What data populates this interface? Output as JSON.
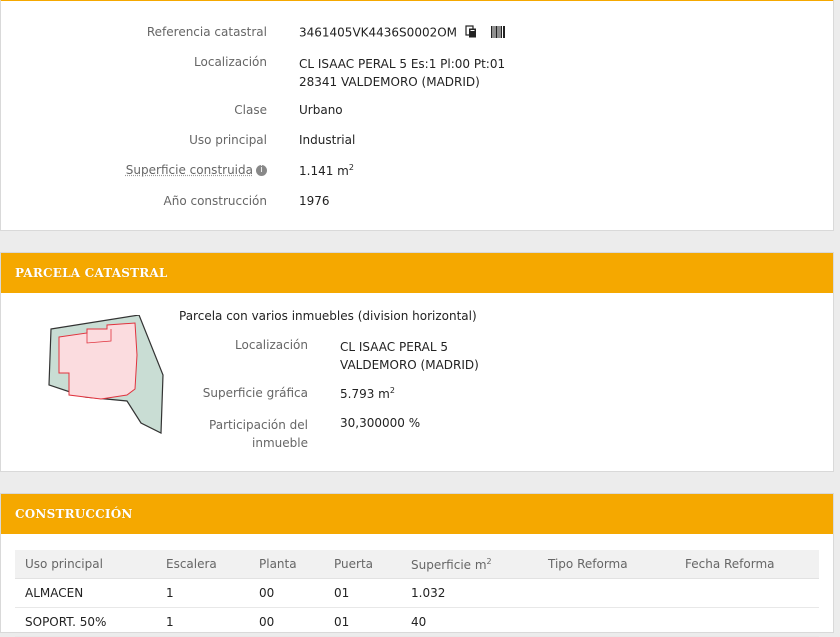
{
  "inmueble": {
    "ref_label": "Referencia catastral",
    "ref_value": "3461405VK4436S0002OM",
    "loc_label": "Localización",
    "loc_line1": "CL ISAAC PERAL 5 Es:1 Pl:00 Pt:01",
    "loc_line2": "28341 VALDEMORO (MADRID)",
    "clase_label": "Clase",
    "clase_value": "Urbano",
    "uso_label": "Uso principal",
    "uso_value": "Industrial",
    "sup_label": "Superficie construida",
    "sup_value": "1.141 m",
    "sup_unit_sup": "2",
    "anio_label": "Año construcción",
    "anio_value": "1976",
    "icons": [
      "copy-icon",
      "barcode-icon",
      "info-icon"
    ]
  },
  "parcela": {
    "header": "PARCELA CATASTRAL",
    "title": "Parcela con varios inmuebles (division horizontal)",
    "loc_label": "Localización",
    "loc_line1": "CL ISAAC PERAL 5",
    "loc_line2": "VALDEMORO (MADRID)",
    "sup_label": "Superficie gráfica",
    "sup_value": "5.793 m",
    "sup_unit_sup": "2",
    "part_label_1": "Participación del",
    "part_label_2": "inmueble",
    "part_value": "30,300000 %",
    "colors": {
      "parcel_fill": "#c9ddd4",
      "building_fill": "#fbdcdf",
      "building_stroke": "#e0333e"
    }
  },
  "construccion": {
    "header": "CONSTRUCCIÓN",
    "columns": [
      "Uso principal",
      "Escalera",
      "Planta",
      "Puerta",
      "Superficie m",
      "Tipo Reforma",
      "Fecha Reforma"
    ],
    "sup_col_sup": "2",
    "rows": [
      [
        "ALMACEN",
        "1",
        "00",
        "01",
        "1.032",
        "",
        ""
      ],
      [
        "SOPORT. 50%",
        "1",
        "00",
        "01",
        "40",
        "",
        ""
      ]
    ]
  },
  "theme": {
    "accent": "#f5a800"
  }
}
